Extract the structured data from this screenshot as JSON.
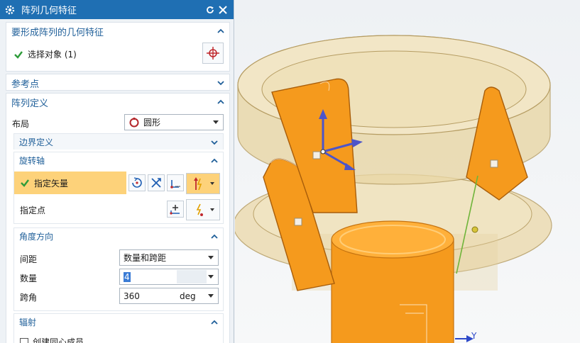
{
  "dialog": {
    "title": "阵列几何特征",
    "reset_icon": "reset-icon",
    "close_icon": "close-icon",
    "settings_icon": "gear-icon"
  },
  "features_section": {
    "title": "要形成阵列的几何特征",
    "select_label": "选择对象 (1)",
    "select_icon": "crosshair-icon"
  },
  "reference_section": {
    "title": "参考点"
  },
  "array_def_section": {
    "title": "阵列定义",
    "layout_label": "布局",
    "layout_value": "圆形",
    "boundary_title": "边界定义",
    "rotation_axis": {
      "title": "旋转轴",
      "vector_label": "指定矢量",
      "point_label": "指定点"
    },
    "angle_direction": {
      "title": "角度方向",
      "spacing_label": "间距",
      "spacing_value": "数量和跨距",
      "count_label": "数量",
      "count_value": "4",
      "span_label": "跨角",
      "span_value": "360",
      "span_unit": "deg"
    },
    "radiate": {
      "title": "辐射",
      "concentric_label": "创建同心成员"
    }
  },
  "viewport": {
    "axis_label": "Y",
    "colors": {
      "part": "#f59a1d",
      "housing": "#e8d39f",
      "highlight": "#ffb03a"
    }
  }
}
